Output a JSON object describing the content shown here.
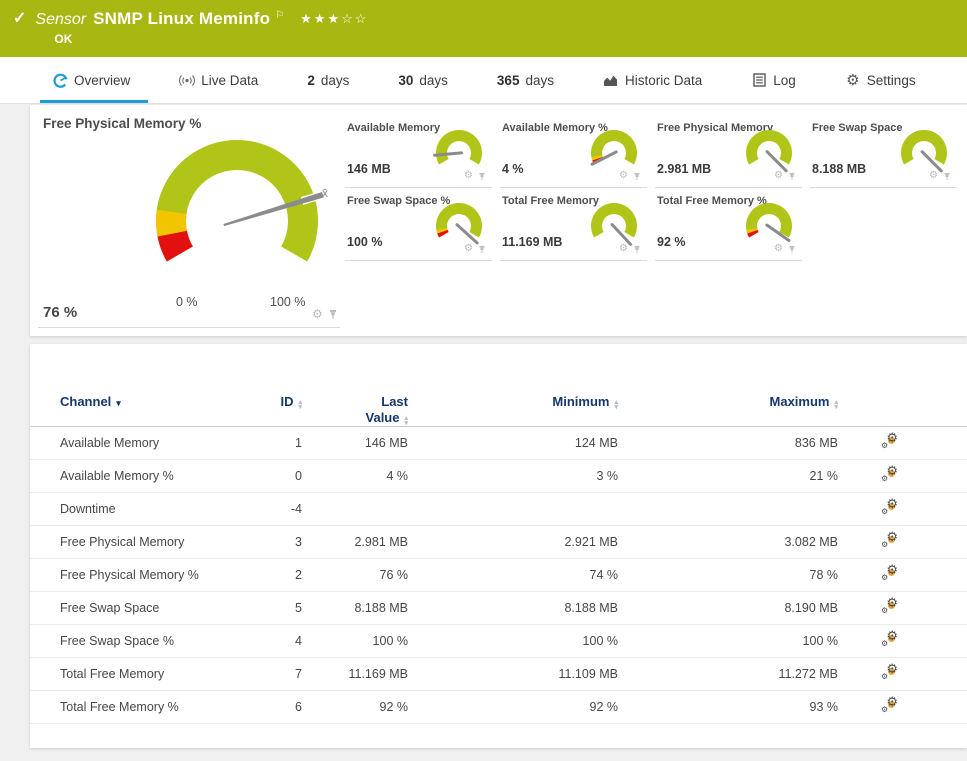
{
  "header": {
    "kind_label": "Sensor",
    "title": "SNMP Linux Meminfo",
    "status": "OK",
    "stars": "★★★☆☆",
    "rating_filled": 3,
    "rating_total": 5,
    "bg_color": "#a9b712"
  },
  "tabs": {
    "overview": "Overview",
    "live_data": "Live Data",
    "d2_num": "2",
    "d2_label": "days",
    "d30_num": "30",
    "d30_label": "days",
    "d365_num": "365",
    "d365_label": "days",
    "historic": "Historic Data",
    "log": "Log",
    "settings": "Settings",
    "active_tab": "Overview",
    "accent_color": "#1e9cd7"
  },
  "icons": {
    "check": "✓",
    "flag": "⚐",
    "gear": "⚙",
    "sort_up": "▴",
    "sort_down": "▾",
    "channel_sort": "▾",
    "avg_marker": "x̄"
  },
  "chart_data": {
    "type": "gauge",
    "colors": {
      "ok_green": "#b0c518",
      "warn_yellow": "#f2c500",
      "error_red": "#e31010",
      "needle_gray": "#8b8b8b"
    },
    "main": {
      "title": "Free Physical Memory %",
      "value": "76 %",
      "value_num": 76,
      "axis_min_label": "0 %",
      "axis_max_label": "100 %",
      "needle_deg": -17
    },
    "minis": [
      {
        "title": "Available Memory",
        "value": "146 MB",
        "needle_deg": 175,
        "warn_segments": false
      },
      {
        "title": "Available Memory %",
        "value": "4 %",
        "needle_deg": 153,
        "warn_segments": true
      },
      {
        "title": "Free Physical Memory",
        "value": "2.981 MB",
        "needle_deg": 45,
        "warn_segments": false
      },
      {
        "title": "Free Swap Space",
        "value": "8.188 MB",
        "needle_deg": 45,
        "warn_segments": false
      },
      {
        "title": "Free Swap Space %",
        "value": "100 %",
        "needle_deg": 42,
        "warn_segments": true
      },
      {
        "title": "Total Free Memory",
        "value": "11.169 MB",
        "needle_deg": 47,
        "warn_segments": false
      },
      {
        "title": "Total Free Memory %",
        "value": "92 %",
        "needle_deg": 35,
        "warn_segments": true
      }
    ]
  },
  "table": {
    "columns": [
      {
        "label": "Channel",
        "sorted": true
      },
      {
        "label": "ID"
      },
      {
        "label": "Last\nValue"
      },
      {
        "label": "Minimum"
      },
      {
        "label": "Maximum"
      }
    ],
    "rows": [
      {
        "channel": "Available Memory",
        "id": "1",
        "last": "146 MB",
        "min": "124 MB",
        "max": "836 MB"
      },
      {
        "channel": "Available Memory %",
        "id": "0",
        "last": "4 %",
        "min": "3 %",
        "max": "21 %"
      },
      {
        "channel": "Downtime",
        "id": "-4",
        "last": "",
        "min": "",
        "max": ""
      },
      {
        "channel": "Free Physical Memory",
        "id": "3",
        "last": "2.981 MB",
        "min": "2.921 MB",
        "max": "3.082 MB"
      },
      {
        "channel": "Free Physical Memory %",
        "id": "2",
        "last": "76 %",
        "min": "74 %",
        "max": "78 %"
      },
      {
        "channel": "Free Swap Space",
        "id": "5",
        "last": "8.188 MB",
        "min": "8.188 MB",
        "max": "8.190 MB"
      },
      {
        "channel": "Free Swap Space %",
        "id": "4",
        "last": "100 %",
        "min": "100 %",
        "max": "100 %"
      },
      {
        "channel": "Total Free Memory",
        "id": "7",
        "last": "11.169 MB",
        "min": "11.109 MB",
        "max": "11.272 MB"
      },
      {
        "channel": "Total Free Memory %",
        "id": "6",
        "last": "92 %",
        "min": "92 %",
        "max": "93 %"
      }
    ]
  }
}
